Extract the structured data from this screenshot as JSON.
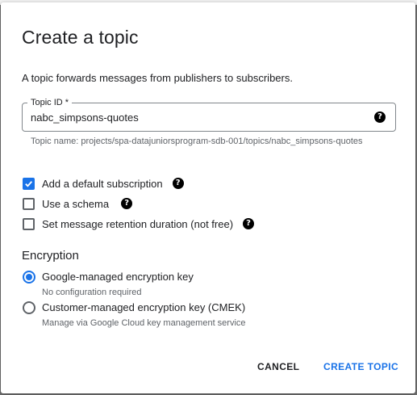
{
  "dialog": {
    "title": "Create a topic",
    "description": "A topic forwards messages from publishers to subscribers.",
    "topic_id": {
      "label": "Topic ID *",
      "value": "nabc_simpsons-quotes",
      "hint": "Topic name: projects/spa-datajuniorsprogram-sdb-001/topics/nabc_simpsons-quotes"
    },
    "options": [
      {
        "label": "Add a default subscription",
        "checked": true
      },
      {
        "label": "Use a schema",
        "checked": false
      },
      {
        "label": "Set message retention duration (not free)",
        "checked": false
      }
    ],
    "encryption": {
      "title": "Encryption",
      "choices": [
        {
          "label": "Google-managed encryption key",
          "sublabel": "No configuration required",
          "selected": true
        },
        {
          "label": "Customer-managed encryption key (CMEK)",
          "sublabel": "Manage via Google Cloud key management service",
          "selected": false
        }
      ]
    },
    "buttons": {
      "cancel": "CANCEL",
      "create": "CREATE TOPIC"
    }
  },
  "icons": {
    "help": "help-circle-icon",
    "check": "check-icon"
  },
  "colors": {
    "accent": "#1a73e8",
    "text": "#202124",
    "secondary_text": "#5f6368"
  }
}
